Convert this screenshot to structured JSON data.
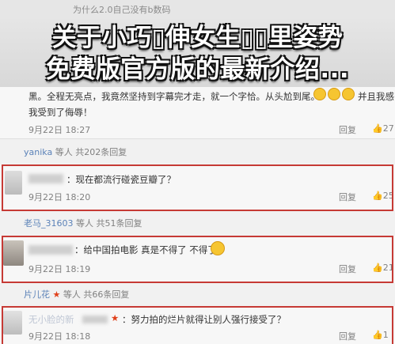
{
  "top_hint": "为什么2.0自己没有b数码",
  "overlay_title": [
    "关于小巧▯伸女生▯▯里姿势",
    "免费版官方版的最新介绍..."
  ],
  "comments": [
    {
      "text_line1": "黑。全程无亮点，我竟然坚持到字幕完才走，就一个字恰。从头尬到尾。",
      "text_tail": "并且我感",
      "text_line2": "我受到了侮辱！",
      "date": "9月22日 18:27",
      "reply_label": "回复",
      "like_count": "27",
      "sub_reply": {
        "name": "yanika",
        "text": "等人 共202条回复",
        "prefix": "等人"
      }
    },
    {
      "user_blur": "...",
      "text": "：现在都流行碰瓷豆瓣了？",
      "date": "9月22日 18:20",
      "reply_label": "回复",
      "like_count": "25",
      "sub_reply": {
        "name": "老马_31603",
        "text": "等人 共51条回复"
      }
    },
    {
      "text": "：给中国拍电影  真是不得了 不得了",
      "date": "9月22日 18:19",
      "reply_label": "回复",
      "like_count": "21",
      "sub_reply": {
        "name": "片儿花",
        "text": "等人 共66条回复"
      }
    },
    {
      "user": "无小脸的新",
      "text": "：努力拍的烂片就得让别人强行接受了？",
      "date": "9月22日 18:18",
      "reply_label": "回复",
      "like_count": "1"
    }
  ],
  "colors": {
    "highlight": "#c63a35",
    "link": "#5b82b8",
    "meta": "#808080"
  }
}
